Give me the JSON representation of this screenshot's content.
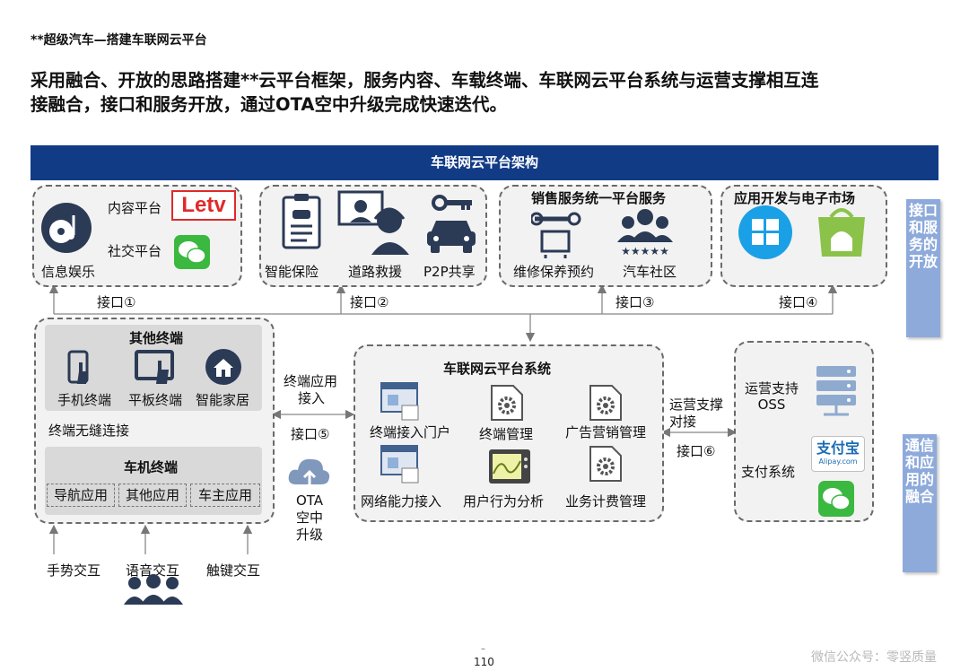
{
  "header": {
    "super_title": "**超级汽车—搭建车联网云平台",
    "headline_line1": "采用融合、开放的思路搭建**云平台框架，服务内容、车载终端、车联网云平台系统与运营支撑相互连",
    "headline_line2": "接融合，接口和服务开放，通过OTA空中升级完成快速迭代。"
  },
  "banner": {
    "title": "车联网云平台架构"
  },
  "services": {
    "entertainment": {
      "content_platform": "内容平台",
      "logo_text": "Letv",
      "social_platform": "社交平台",
      "info_ent": "信息娱乐"
    },
    "insurance_box": {
      "smart_insurance": "智能保险",
      "road_rescue": "道路救援",
      "p2p": "P2P共享"
    },
    "sales_box": {
      "title": "销售服务统一平台服务",
      "maintenance": "维修保养预约",
      "community": "汽车社区"
    },
    "app_box": {
      "title": "应用开发与电子市场"
    }
  },
  "interfaces": {
    "if1": "接口①",
    "if2": "接口②",
    "if3": "接口③",
    "if4": "接口④",
    "if5": "接口⑤",
    "if6": "接口⑥"
  },
  "side_tags": {
    "open": "接口和服务的开放",
    "fusion": "通信和应用的融合"
  },
  "terminals": {
    "other_title": "其他终端",
    "phone": "手机终端",
    "tablet": "平板终端",
    "home": "智能家居",
    "seamless": "终端无缝连接",
    "vehicle_title": "车机终端",
    "apps": [
      "导航应用",
      "其他应用",
      "车主应用"
    ]
  },
  "interactions": {
    "gesture": "手势交互",
    "voice": "语音交互",
    "touch": "触键交互"
  },
  "middle": {
    "terminal_access_l1": "终端应用",
    "terminal_access_l2": "接入",
    "ota_l1": "OTA",
    "ota_l2": "空中",
    "ota_l3": "升级"
  },
  "cloud": {
    "title": "车联网云平台系统",
    "modules": [
      "终端接入门户",
      "终端管理",
      "广告营销管理",
      "网络能力接入",
      "用户行为分析",
      "业务计费管理"
    ]
  },
  "ops": {
    "support_l1": "运营支撑",
    "support_l2": "对接",
    "oss_l1": "运营支持",
    "oss_l2": "OSS",
    "pay": "支付系统",
    "alipay_l1": "支付宝",
    "alipay_l2": "Alipay.com"
  },
  "footer": {
    "page_num": "110",
    "dash": "–",
    "watermark": "微信公众号：零竖质量"
  },
  "colors": {
    "banner": "#123b86",
    "side_tag": "#8eaadb",
    "icon_dark": "#2b3a55",
    "wechat_green": "#3bb83f",
    "win_blue": "#1aa0e6",
    "android_green": "#8bc34a",
    "letv_red": "#e0292a"
  }
}
